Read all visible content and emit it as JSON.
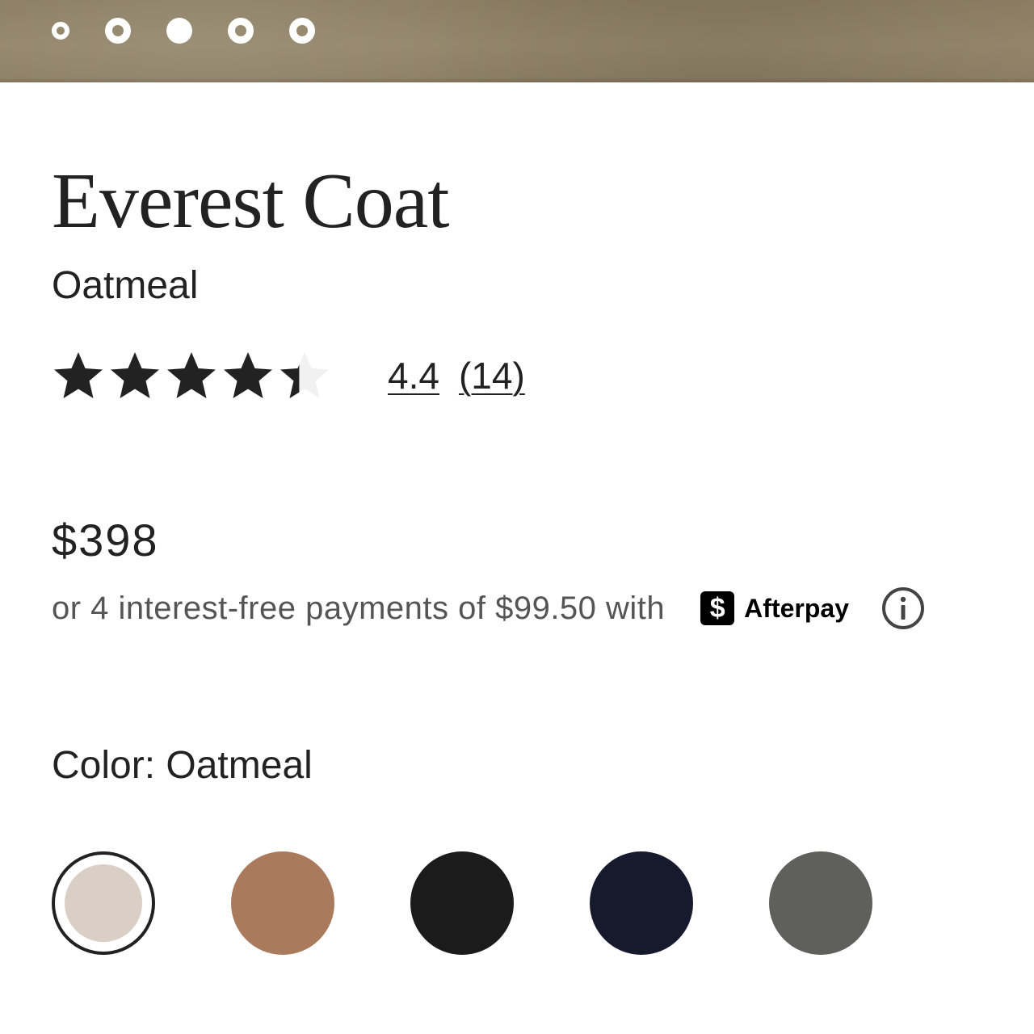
{
  "gallery": {
    "dots": [
      {
        "state": "inactive"
      },
      {
        "state": "inactive"
      },
      {
        "state": "active"
      },
      {
        "state": "inactive"
      },
      {
        "state": "inactive"
      }
    ],
    "active_index": 2
  },
  "product": {
    "title": "Everest Coat",
    "subtitle": "Oatmeal",
    "rating": {
      "value": "4.4",
      "count": "(14)",
      "stars_total": 5,
      "stars_filled": 4.4
    },
    "price": "$398",
    "afterpay": {
      "text": "or 4 interest-free payments of $99.50 with",
      "brand": "Afterpay",
      "brand_icon": "$",
      "info_icon": "info-icon"
    },
    "color": {
      "label": "Color:",
      "selected": "Oatmeal",
      "swatches": [
        {
          "color": "#d9cfc4",
          "selected": true
        },
        {
          "color": "#a97a5c",
          "selected": false
        },
        {
          "color": "#1b1b1b",
          "selected": false
        },
        {
          "color": "#161a2c",
          "selected": false
        },
        {
          "color": "#5f5f5b",
          "selected": false
        }
      ]
    }
  }
}
